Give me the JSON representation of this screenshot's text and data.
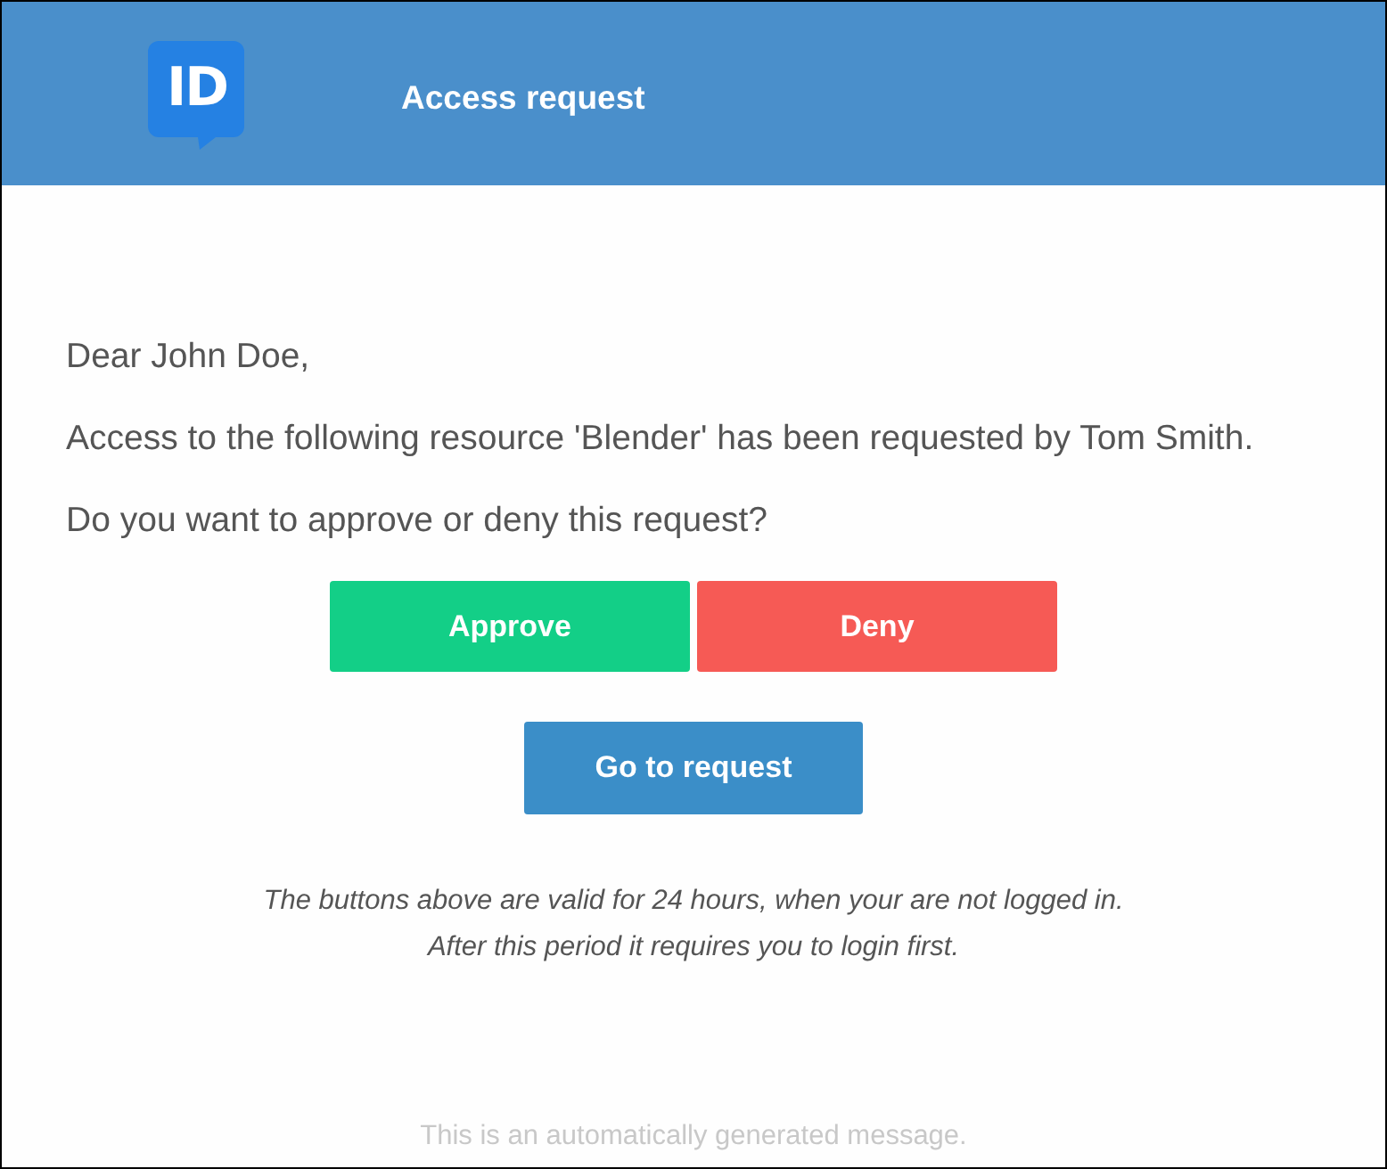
{
  "header": {
    "logo": {
      "text": "ID"
    },
    "title": "Access request"
  },
  "message": {
    "paragraphs": [
      "Dear John Doe,",
      "Access to the following resource 'Blender' has been requested by Tom Smith.",
      "Do you want to approve or deny this request?"
    ]
  },
  "decision_buttons": [
    {
      "label": "Approve",
      "kind": "approve"
    },
    {
      "label": "Deny",
      "kind": "deny"
    }
  ],
  "link_button": {
    "label": "Go to request"
  },
  "notes": [
    "The buttons above are valid for 24 hours, when your are not logged in.",
    "After this period it requires you to login first."
  ],
  "footer": "This is an automatically generated message."
}
